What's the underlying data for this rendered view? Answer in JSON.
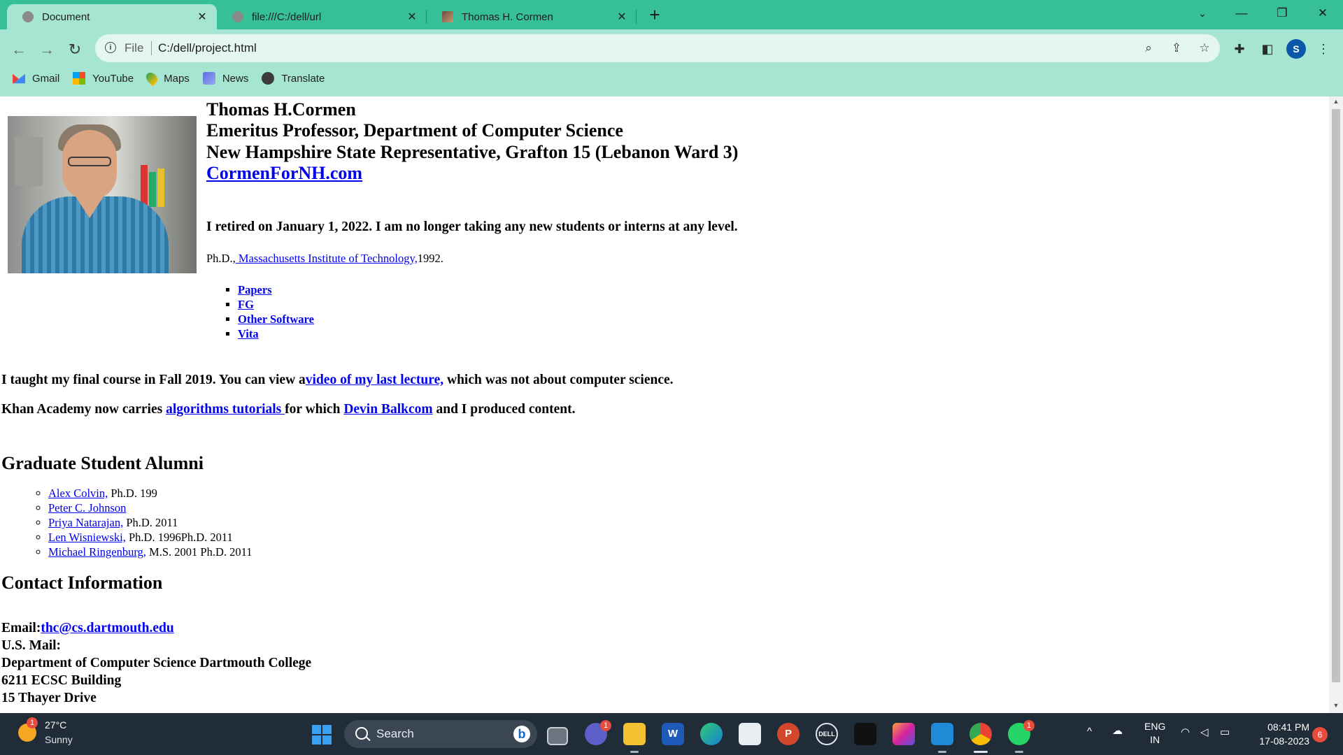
{
  "browser": {
    "tabs": [
      {
        "title": "Document",
        "active": true
      },
      {
        "title": "file:///C:/dell/url",
        "active": false
      },
      {
        "title": "Thomas H. Cormen",
        "active": false
      }
    ],
    "new_tab_label": "+",
    "address": {
      "scheme_label": "File",
      "url": "C:/dell/project.html"
    },
    "bookmarks": [
      "Gmail",
      "YouTube",
      "Maps",
      "News",
      "Translate"
    ],
    "profile_initial": "S",
    "window_controls": {
      "minimize": "—",
      "restore": "❐",
      "close": "✕"
    },
    "theme_color": "#37bf98",
    "toolbar_color": "#a7e5d3"
  },
  "page": {
    "name": "Thomas H.Cormen",
    "title_line1": "Emeritus Professor, Department of Computer Science",
    "title_line2": "New Hampshire State Representative, Grafton 15 (Lebanon Ward 3)",
    "site_link": "CormenForNH.com",
    "retired_note": "I retired on January 1, 2022. I am no longer taking any new students or interns at any level.",
    "phd_prefix": "Ph.D.,",
    "phd_school": " Massachusetts Institute of Technology,",
    "phd_year": "1992.",
    "links": [
      "Papers",
      "FG",
      "Other Software",
      "Vita"
    ],
    "lecture": {
      "before": "I taught my final course in Fall 2019. You can view a",
      "link": "video of my last lecture,",
      "after": " which was not about computer science."
    },
    "khan": {
      "before": "Khan Academy now carries ",
      "link1": "algorithms tutorials ",
      "middle": "for which ",
      "link2": "Devin Balkcom",
      "after": " and I produced content."
    },
    "alumni_heading": "Graduate Student Alumni",
    "alumni": [
      {
        "name": "Alex Colvin,",
        "detail": " Ph.D. 199"
      },
      {
        "name": "Peter C. Johnson",
        "detail": ""
      },
      {
        "name": "Priya Natarajan,",
        "detail": " Ph.D. 2011"
      },
      {
        "name": "Len Wisniewski,",
        "detail": " Ph.D. 1996Ph.D. 2011"
      },
      {
        "name": "Michael Ringenburg,",
        "detail": " M.S. 2001 Ph.D. 2011"
      }
    ],
    "contact_heading": "Contact Information",
    "email_label": "Email:",
    "email": "thc@cs.dartmouth.edu",
    "mail_label": "U.S. Mail:",
    "address_lines": [
      "Department of Computer Science Dartmouth College",
      "6211 ECSC Building",
      "15 Thayer Drive"
    ],
    "link_color": "#0000ee"
  },
  "taskbar": {
    "weather_temp": "27°C",
    "weather_condition": "Sunny",
    "weather_badge": "1",
    "search_placeholder": "Search",
    "bing_label": "b",
    "teams_badge": "1",
    "whatsapp_badge": "1",
    "language_line1": "ENG",
    "language_line2": "IN",
    "time": "08:41 PM",
    "date": "17-08-2023",
    "notification_count": "6"
  }
}
